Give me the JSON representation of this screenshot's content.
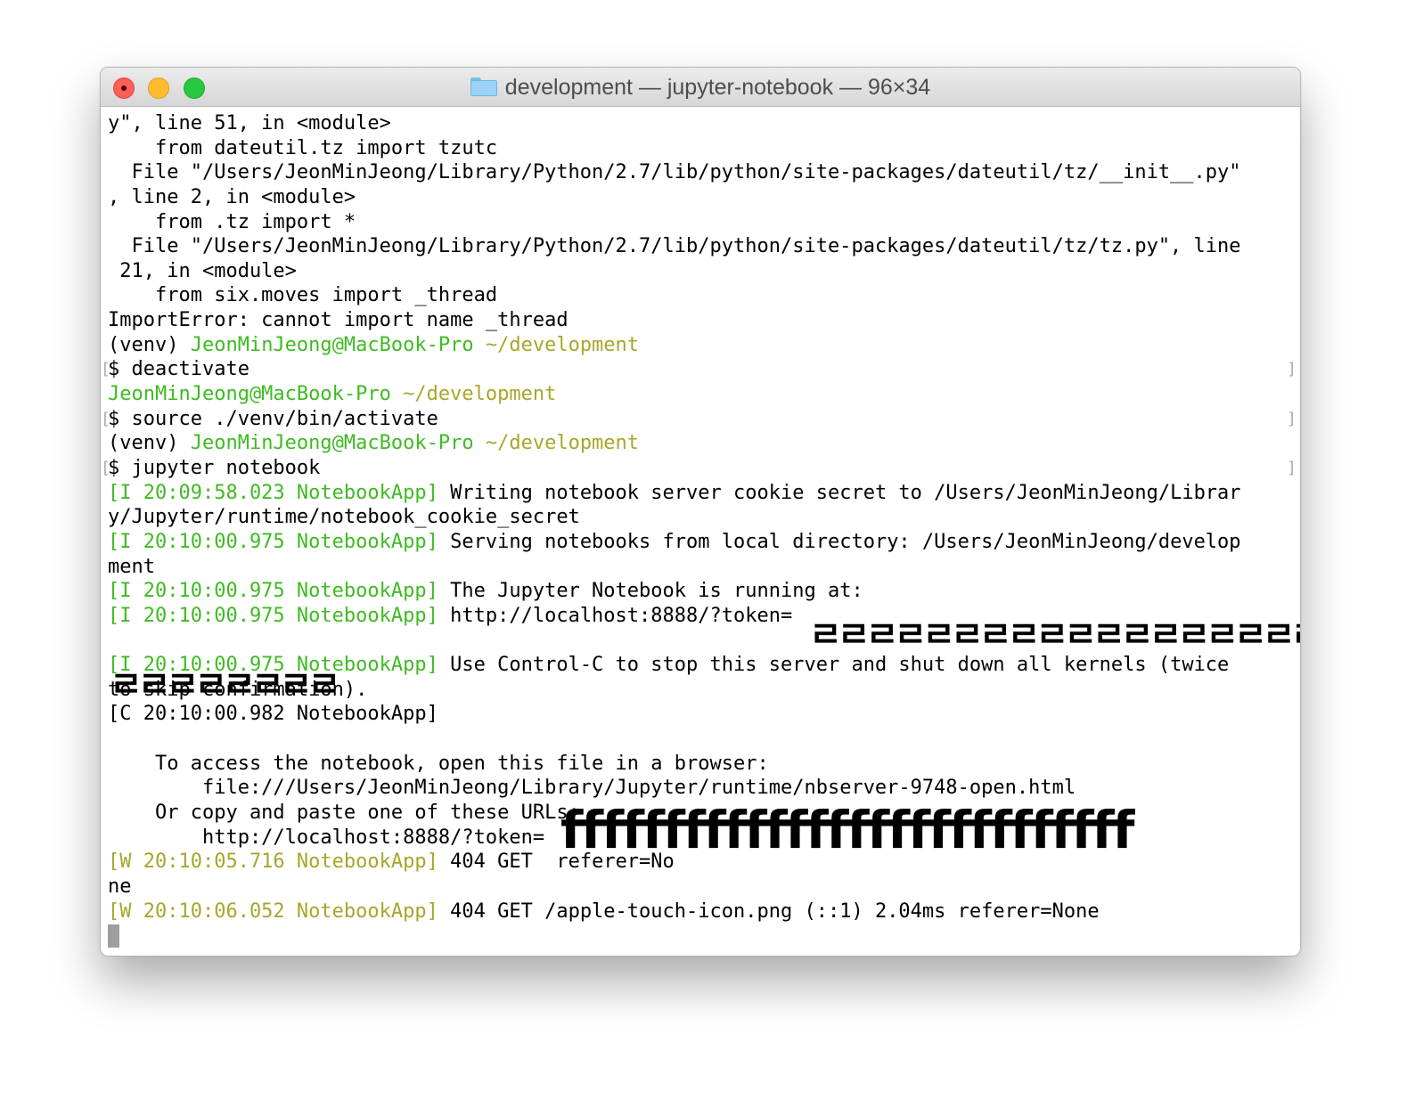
{
  "window": {
    "title": "development — jupyter-notebook — 96×34",
    "buttons": [
      "close",
      "minimize",
      "maximize"
    ],
    "icon": "folder-icon"
  },
  "colors": {
    "prompt_green": "#3fbb22",
    "path_olive": "#a8a62a",
    "warning_olive": "#a8a62a",
    "cursor": "#9e9e9e"
  },
  "terminal": {
    "lines": [
      [
        {
          "t": "y\", line 51, in <module>",
          "c": "black"
        }
      ],
      [
        {
          "t": "    from dateutil.tz import tzutc",
          "c": "black"
        }
      ],
      [
        {
          "t": "  File \"/Users/JeonMinJeong/Library/Python/2.7/lib/python/site-packages/dateutil/tz/__init__.py\"",
          "c": "black"
        }
      ],
      [
        {
          "t": ", line 2, in <module>",
          "c": "black"
        }
      ],
      [
        {
          "t": "    from .tz import *",
          "c": "black"
        }
      ],
      [
        {
          "t": "  File \"/Users/JeonMinJeong/Library/Python/2.7/lib/python/site-packages/dateutil/tz/tz.py\", line",
          "c": "black"
        }
      ],
      [
        {
          "t": " 21, in <module>",
          "c": "black"
        }
      ],
      [
        {
          "t": "    from six.moves import _thread",
          "c": "black"
        }
      ],
      [
        {
          "t": "ImportError: cannot import name _thread",
          "c": "black"
        }
      ],
      [
        {
          "t": "(venv) ",
          "c": "black"
        },
        {
          "t": "JeonMinJeong@MacBook-Pro",
          "c": "green"
        },
        {
          "t": " ~/development",
          "c": "olive"
        }
      ],
      [
        {
          "t": "$ deactivate",
          "c": "black"
        }
      ],
      [
        {
          "t": "JeonMinJeong@MacBook-Pro",
          "c": "green"
        },
        {
          "t": " ~/development",
          "c": "olive"
        }
      ],
      [
        {
          "t": "$ source ./venv/bin/activate",
          "c": "black"
        }
      ],
      [
        {
          "t": "(venv) ",
          "c": "black"
        },
        {
          "t": "JeonMinJeong@MacBook-Pro",
          "c": "green"
        },
        {
          "t": " ~/development",
          "c": "olive"
        }
      ],
      [
        {
          "t": "$ jupyter notebook",
          "c": "black"
        }
      ],
      [
        {
          "t": "[I 20:09:58.023 NotebookApp]",
          "c": "green"
        },
        {
          "t": " Writing notebook server cookie secret to /Users/JeonMinJeong/Librar",
          "c": "black"
        }
      ],
      [
        {
          "t": "y/Jupyter/runtime/notebook_cookie_secret",
          "c": "black"
        }
      ],
      [
        {
          "t": "[I 20:10:00.975 NotebookApp]",
          "c": "green"
        },
        {
          "t": " Serving notebooks from local directory: /Users/JeonMinJeong/develop",
          "c": "black"
        }
      ],
      [
        {
          "t": "ment",
          "c": "black"
        }
      ],
      [
        {
          "t": "[I 20:10:00.975 NotebookApp]",
          "c": "green"
        },
        {
          "t": " The Jupyter Notebook is running at:",
          "c": "black"
        }
      ],
      [
        {
          "t": "[I 20:10:00.975 NotebookApp]",
          "c": "green"
        },
        {
          "t": " http://localhost:8888/?token=",
          "c": "black"
        }
      ],
      [
        {
          "t": "",
          "c": "black"
        }
      ],
      [
        {
          "t": "[I 20:10:00.975 NotebookApp]",
          "c": "green"
        },
        {
          "t": " Use Control-C to stop this server and shut down all kernels (twice",
          "c": "black"
        }
      ],
      [
        {
          "t": "to skip confirmation).",
          "c": "black"
        }
      ],
      [
        {
          "t": "[C 20:10:00.982 NotebookApp]",
          "c": "black"
        }
      ],
      [
        {
          "t": "",
          "c": "black"
        }
      ],
      [
        {
          "t": "    To access the notebook, open this file in a browser:",
          "c": "black"
        }
      ],
      [
        {
          "t": "        file:///Users/JeonMinJeong/Library/Jupyter/runtime/nbserver-9748-open.html",
          "c": "black"
        }
      ],
      [
        {
          "t": "    Or copy and paste one of these URLs:",
          "c": "black"
        }
      ],
      [
        {
          "t": "        http://localhost:8888/?token=",
          "c": "black"
        }
      ],
      [
        {
          "t": "[W 20:10:05.716 NotebookApp]",
          "c": "olive"
        },
        {
          "t": " 404 GET ",
          "c": "black"
        },
        {
          "t": "",
          "c": "black"
        },
        {
          "t": " referer=No",
          "c": "black"
        }
      ],
      [
        {
          "t": "ne",
          "c": "black"
        }
      ],
      [
        {
          "t": "[W 20:10:06.052 NotebookApp]",
          "c": "olive"
        },
        {
          "t": " 404 GET /apple-touch-icon.png (::1) 2.04ms referer=None",
          "c": "black"
        }
      ]
    ],
    "bracket_marks": [
      {
        "line": 10,
        "left": "[",
        "right": "]"
      },
      {
        "line": 12,
        "left": "[",
        "right": "]"
      },
      {
        "line": 14,
        "left": "[",
        "right": "]"
      }
    ],
    "redactions": {
      "token_line": "ㄹㄹㄹㄹㄹㄹㄹㄹㄹㄹㄹㄹㄹㄹㄹㄹㄹㄹㄹㄹ",
      "token_wrap": "ㄹㄹㄹㄹㄹㄹㄹㄹ",
      "url_block": "ffffffffffffffffffffffffffff"
    }
  }
}
